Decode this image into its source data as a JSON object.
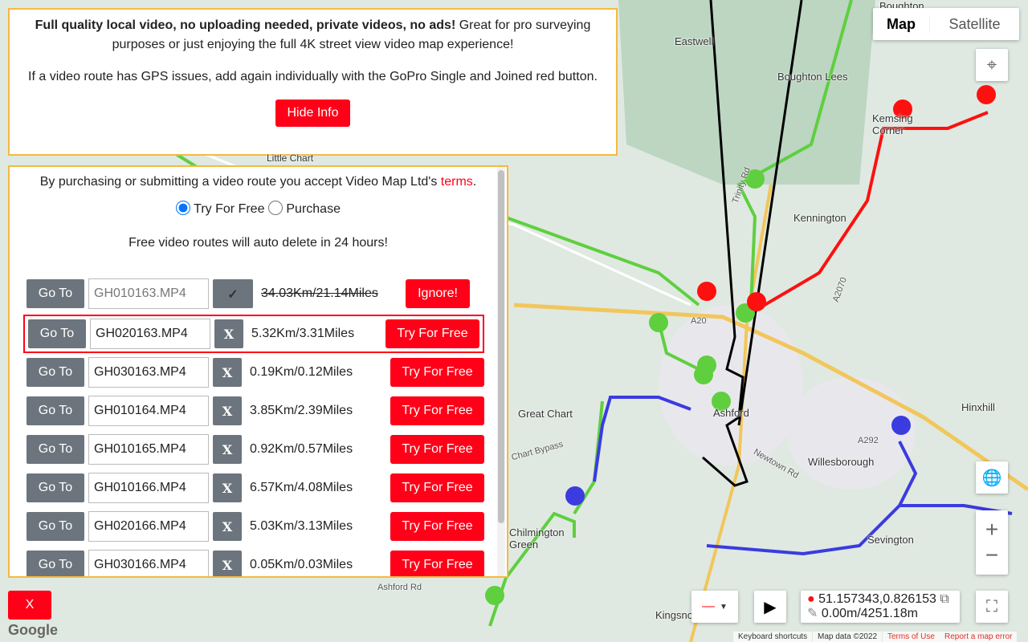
{
  "info": {
    "bold_text": "Full quality local video, no uploading needed, private videos, no ads!",
    "text": " Great for pro surveying purposes or just enjoying the full 4K street view video map experience!",
    "gps_text": "If a video route has GPS issues, add again individually with the GoPro Single and Joined red button.",
    "hide_label": "Hide Info"
  },
  "terms": {
    "prefix": "By purchasing or submitting a video route you accept Video Map Ltd's ",
    "link": "terms",
    "suffix": "."
  },
  "mode": {
    "option1": "Try For Free",
    "option2": "Purchase",
    "selected": "Try For Free"
  },
  "notice": "Free video routes will auto delete in 24 hours!",
  "routes": [
    {
      "goto": "Go To",
      "file": "GH010163.MP4",
      "toggle": "✓",
      "distance": "34.03Km/21.14Miles",
      "action": "Ignore!",
      "disabled": true
    },
    {
      "goto": "Go To",
      "file": "GH020163.MP4",
      "toggle": "X",
      "distance": "5.32Km/3.31Miles",
      "action": "Try For Free",
      "highlighted": true
    },
    {
      "goto": "Go To",
      "file": "GH030163.MP4",
      "toggle": "X",
      "distance": "0.19Km/0.12Miles",
      "action": "Try For Free"
    },
    {
      "goto": "Go To",
      "file": "GH010164.MP4",
      "toggle": "X",
      "distance": "3.85Km/2.39Miles",
      "action": "Try For Free"
    },
    {
      "goto": "Go To",
      "file": "GH010165.MP4",
      "toggle": "X",
      "distance": "0.92Km/0.57Miles",
      "action": "Try For Free"
    },
    {
      "goto": "Go To",
      "file": "GH010166.MP4",
      "toggle": "X",
      "distance": "6.57Km/4.08Miles",
      "action": "Try For Free"
    },
    {
      "goto": "Go To",
      "file": "GH020166.MP4",
      "toggle": "X",
      "distance": "5.03Km/3.13Miles",
      "action": "Try For Free"
    },
    {
      "goto": "Go To",
      "file": "GH030166.MP4",
      "toggle": "X",
      "distance": "0.05Km/0.03Miles",
      "action": "Try For Free"
    }
  ],
  "map": {
    "type_map": "Map",
    "type_satellite": "Satellite",
    "places": [
      "Boughton",
      "Eastwell",
      "Boughton Lees",
      "Kemsing Corner",
      "Kennington",
      "Little Chart",
      "Great Chart",
      "Ashford",
      "Hinxhill",
      "Willesborough",
      "Chilmington Green",
      "Sevington",
      "Kingsnorth",
      "Trinity Rd",
      "A20",
      "A2070",
      "A292",
      "Newtown Rd",
      "Chart Bypass",
      "Ashford Rd"
    ],
    "coords": "51.157343,0.826153",
    "distance": "0.00m/4251.18m",
    "close_label": "X",
    "google": "Google",
    "attribution": {
      "shortcuts": "Keyboard shortcuts",
      "data": "Map data ©2022",
      "terms": "Terms of Use",
      "report": "Report a map error"
    }
  },
  "colors": {
    "accent": "#ff0018",
    "panel_border": "#f5b942",
    "button_gray": "#6c757d"
  }
}
